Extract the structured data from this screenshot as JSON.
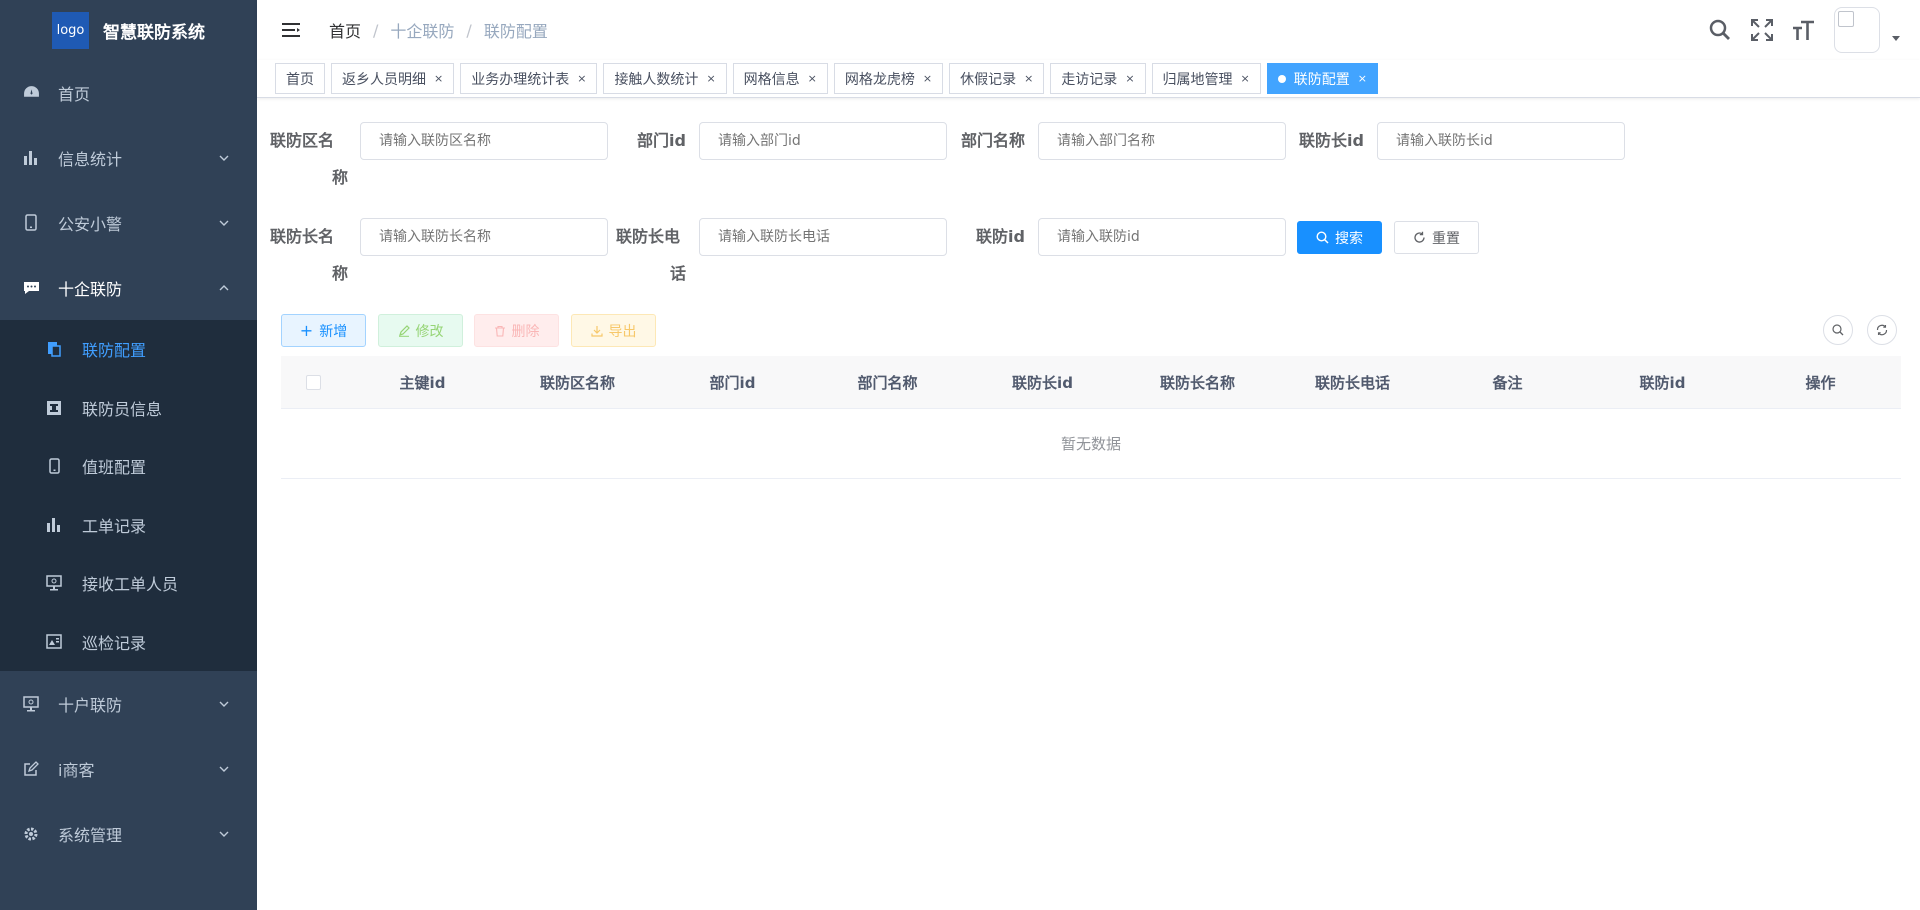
{
  "app": {
    "logo_text": "logo",
    "title": "智慧联防系统"
  },
  "sidebar": {
    "items": [
      {
        "label": "首页",
        "icon": "dashboard-icon"
      },
      {
        "label": "信息统计",
        "icon": "chart-icon"
      },
      {
        "label": "公安小警",
        "icon": "phone-icon"
      },
      {
        "label": "十企联防",
        "icon": "message-icon"
      },
      {
        "label": "十户联防",
        "icon": "monitor-icon"
      },
      {
        "label": "i商客",
        "icon": "edit-icon"
      },
      {
        "label": "系统管理",
        "icon": "gear-icon"
      }
    ],
    "submenu": [
      {
        "label": "联防配置",
        "icon": "docs-icon",
        "active": true
      },
      {
        "label": "联防员信息",
        "icon": "id-icon"
      },
      {
        "label": "值班配置",
        "icon": "phone-icon"
      },
      {
        "label": "工单记录",
        "icon": "chart-icon"
      },
      {
        "label": "接收工单人员",
        "icon": "monitor-icon"
      },
      {
        "label": "巡检记录",
        "icon": "image-icon"
      }
    ]
  },
  "breadcrumb": [
    "首页",
    "十企联防",
    "联防配置"
  ],
  "tags": [
    "首页",
    "返乡人员明细",
    "业务办理统计表",
    "接触人数统计",
    "网格信息",
    "网格龙虎榜",
    "休假记录",
    "走访记录",
    "归属地管理",
    "联防配置"
  ],
  "form": {
    "area_name": {
      "label_1": "联防区名",
      "label_2": "称",
      "placeholder": "请输入联防区名称"
    },
    "dept_id": {
      "label": "部门id",
      "placeholder": "请输入部门id"
    },
    "dept_name": {
      "label": "部门名称",
      "placeholder": "请输入部门名称"
    },
    "leader_id": {
      "label": "联防长id",
      "placeholder": "请输入联防长id"
    },
    "leader_name": {
      "label_1": "联防长名",
      "label_2": "称",
      "placeholder": "请输入联防长名称"
    },
    "leader_phone": {
      "label_1": "联防长电",
      "label_2": "话",
      "placeholder": "请输入联防长电话"
    },
    "defense_id": {
      "label": "联防id",
      "placeholder": "请输入联防id"
    },
    "search_label": "搜索",
    "reset_label": "重置"
  },
  "toolbar": {
    "add": "新增",
    "edit": "修改",
    "delete": "删除",
    "export": "导出"
  },
  "table": {
    "columns": [
      "主键id",
      "联防区名称",
      "部门id",
      "部门名称",
      "联防长id",
      "联防长名称",
      "联防长电话",
      "备注",
      "联防id",
      "操作"
    ],
    "empty_text": "暂无数据"
  },
  "colors": {
    "sidebar_bg": "#304156",
    "submenu_bg": "#1f2d3d",
    "primary": "#1890ff",
    "active_tag": "#42a4ff"
  }
}
